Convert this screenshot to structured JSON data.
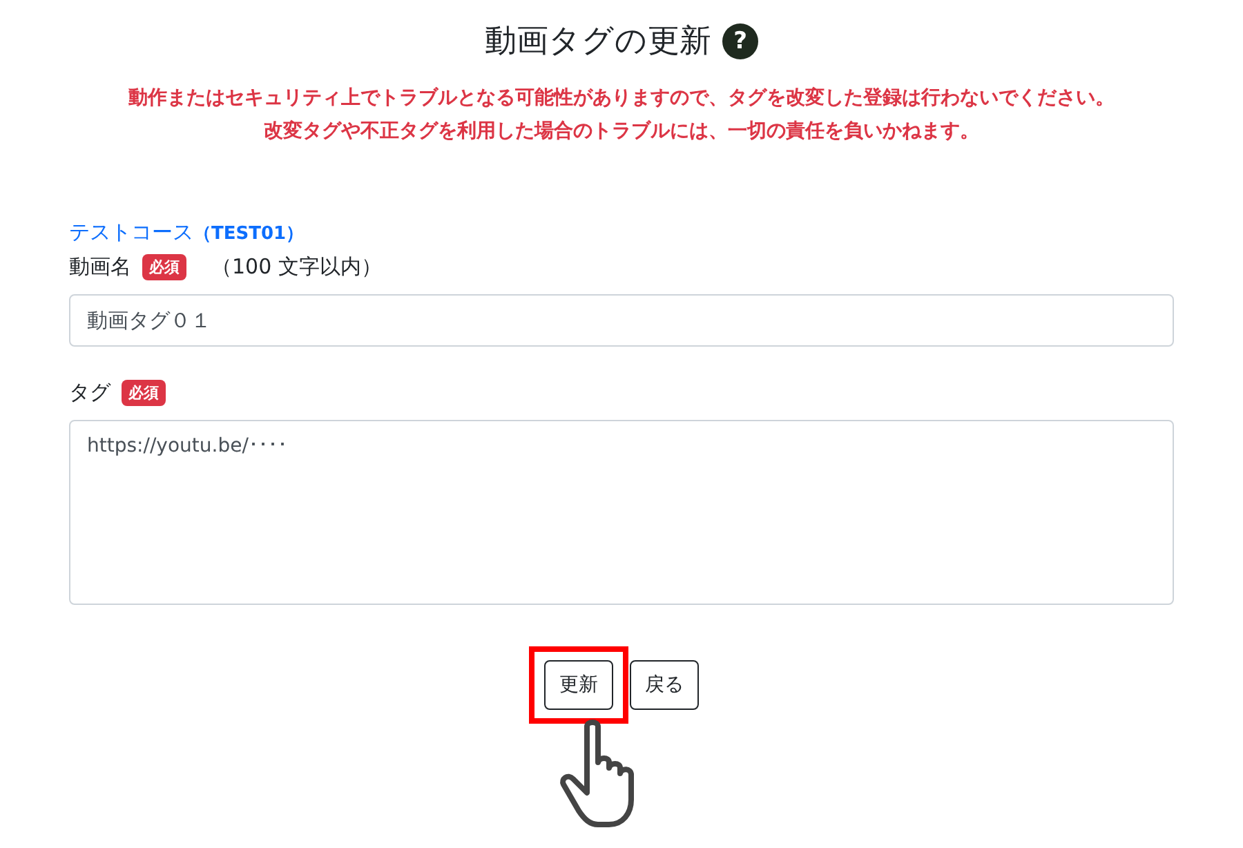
{
  "title": "動画タグの更新",
  "help_icon": "?",
  "warnings": [
    "動作またはセキュリティ上でトラブルとなる可能性がありますので、タグを改変した登録は行わないでください。",
    "改変タグや不正タグを利用した場合のトラブルには、一切の責任を負いかねます。"
  ],
  "course_link": {
    "name": "テストコース",
    "code": "（TEST01）"
  },
  "fields": [
    {
      "kind": "input",
      "label": "動画名",
      "badge": "必須",
      "hint": "（100 文字以内）",
      "value": "動画タグ０１"
    },
    {
      "kind": "textarea",
      "label": "タグ",
      "badge": "必須",
      "value": "https://youtu.be/････"
    }
  ],
  "buttons": [
    {
      "label": "更新",
      "highlighted": true
    },
    {
      "label": "戻る",
      "highlighted": false
    }
  ]
}
